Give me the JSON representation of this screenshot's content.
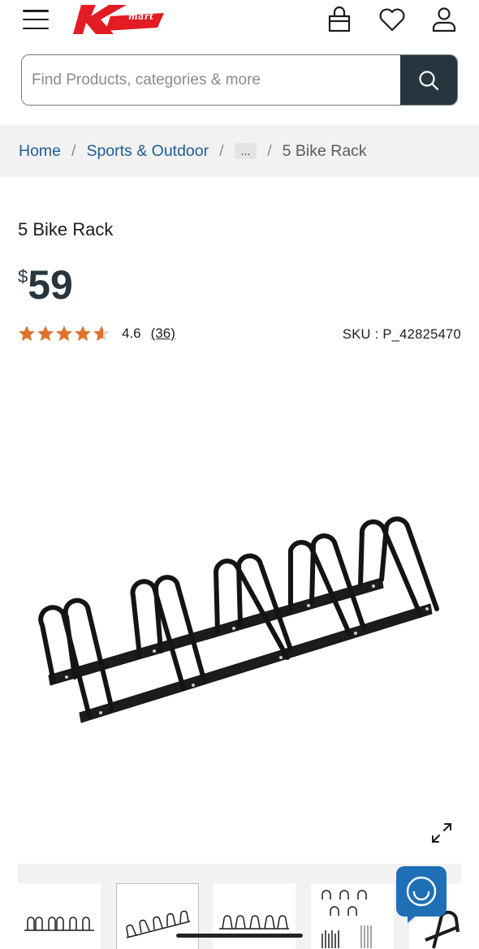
{
  "header": {
    "brand": "mart",
    "icons": [
      "menu-icon",
      "kmart-logo",
      "bag-icon",
      "heart-icon",
      "user-icon"
    ]
  },
  "search": {
    "placeholder": "Find Products, categories & more",
    "value": "",
    "button_icon": "search-icon"
  },
  "breadcrumb": {
    "items": [
      "Home",
      "Sports & Outdoor",
      "...",
      "5 Bike Rack"
    ],
    "separator": "/"
  },
  "product": {
    "title": "5 Bike Rack",
    "price_symbol": "$",
    "price": "59",
    "rating": "4.6",
    "rating_stars": 4.6,
    "reviews": "(36)",
    "sku": "SKU : P_42825470"
  },
  "colors": {
    "brand_red": "#e31b23",
    "primary_dark": "#27353f",
    "link": "#1f5d95",
    "star": "#e0722d",
    "chat": "#1f6fb6"
  },
  "gallery": {
    "expand_icon": "expand-icon",
    "thumbnail_count": 5,
    "active_index": 1
  },
  "chat": {
    "icon": "chat-icon"
  }
}
